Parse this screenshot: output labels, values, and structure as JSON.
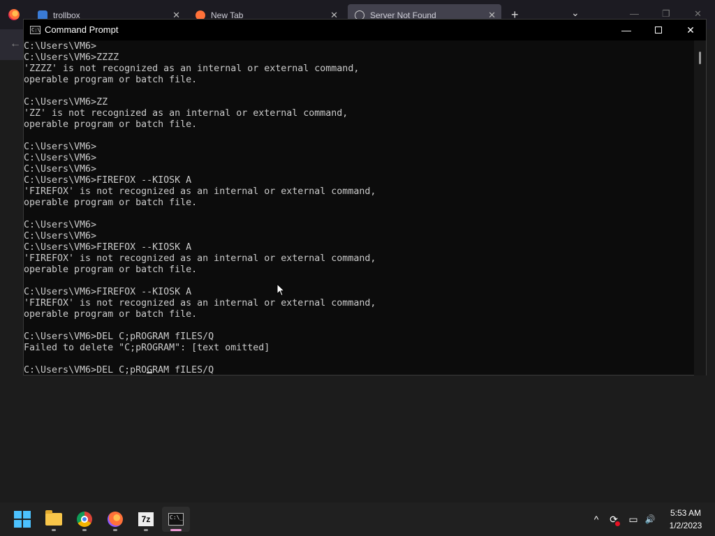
{
  "browser": {
    "tabs": [
      {
        "title": "trollbox",
        "close": "✕"
      },
      {
        "title": "New Tab",
        "close": "✕"
      },
      {
        "title": "Server Not Found",
        "close": "✕"
      }
    ],
    "new_tab": "+",
    "tab_list": "⌄",
    "window_controls": {
      "minimize": "—",
      "restore": "❐",
      "close": "✕"
    },
    "back": "←"
  },
  "cmd": {
    "title": "Command Prompt",
    "icon_text": "C:\\",
    "controls": {
      "minimize": "—",
      "close": "✕"
    },
    "lines": [
      "C:\\Users\\VM6>",
      "C:\\Users\\VM6>ZZZZ",
      "'ZZZZ' is not recognized as an internal or external command,",
      "operable program or batch file.",
      "",
      "C:\\Users\\VM6>ZZ",
      "'ZZ' is not recognized as an internal or external command,",
      "operable program or batch file.",
      "",
      "C:\\Users\\VM6>",
      "C:\\Users\\VM6>",
      "C:\\Users\\VM6>",
      "C:\\Users\\VM6>FIREFOX --KIOSK A",
      "'FIREFOX' is not recognized as an internal or external command,",
      "operable program or batch file.",
      "",
      "C:\\Users\\VM6>",
      "C:\\Users\\VM6>",
      "C:\\Users\\VM6>FIREFOX --KIOSK A",
      "'FIREFOX' is not recognized as an internal or external command,",
      "operable program or batch file.",
      "",
      "C:\\Users\\VM6>FIREFOX --KIOSK A",
      "'FIREFOX' is not recognized as an internal or external command,",
      "operable program or batch file.",
      "",
      "C:\\Users\\VM6>DEL C;pROGRAM fILES/Q",
      "Failed to delete \"C;pROGRAM\": [text omitted]",
      "",
      "C:\\Users\\VM6>DEL C;pROGRAM fILES/Q"
    ]
  },
  "taskbar": {
    "apps": [
      {
        "name": "Start",
        "icon": "windows-start-icon"
      },
      {
        "name": "File Explorer",
        "icon": "file-explorer-icon"
      },
      {
        "name": "Google Chrome",
        "icon": "chrome-icon"
      },
      {
        "name": "Firefox",
        "icon": "firefox-icon"
      },
      {
        "name": "7-Zip",
        "icon": "7zip-icon",
        "label": "7z"
      },
      {
        "name": "Command Prompt",
        "icon": "command-prompt-icon",
        "label": "C:\\_",
        "active": true
      }
    ],
    "tray": {
      "chevron": "^",
      "sync": "⟳",
      "network": "▭",
      "volume": "🔊"
    },
    "time": "5:53 AM",
    "date": "1/2/2023"
  },
  "colors": {
    "console_bg": "#0c0c0c",
    "console_text": "#cccccc",
    "taskbar_bg": "#202020",
    "start_blue": "#4cc2ff",
    "active_indicator": "#f09bd7"
  }
}
